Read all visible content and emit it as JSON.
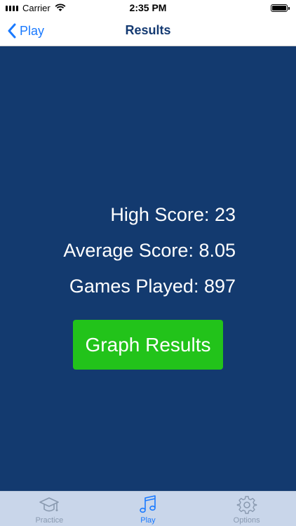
{
  "status_bar": {
    "carrier": "Carrier",
    "time": "2:35 PM"
  },
  "nav": {
    "back_label": "Play",
    "title": "Results"
  },
  "stats": {
    "high_score": "High Score: 23",
    "average_score": "Average Score: 8.05",
    "games_played": "Games Played: 897"
  },
  "graph_button": {
    "label": "Graph Results"
  },
  "tabs": [
    {
      "label": "Practice",
      "icon": "graduation-cap-icon",
      "active": false
    },
    {
      "label": "Play",
      "icon": "music-note-icon",
      "active": true
    },
    {
      "label": "Options",
      "icon": "gear-icon",
      "active": false
    }
  ],
  "colors": {
    "background": "#133a6f",
    "button": "#22c31a",
    "accent": "#1a7aff",
    "tab_bar": "#c9d6ea"
  }
}
